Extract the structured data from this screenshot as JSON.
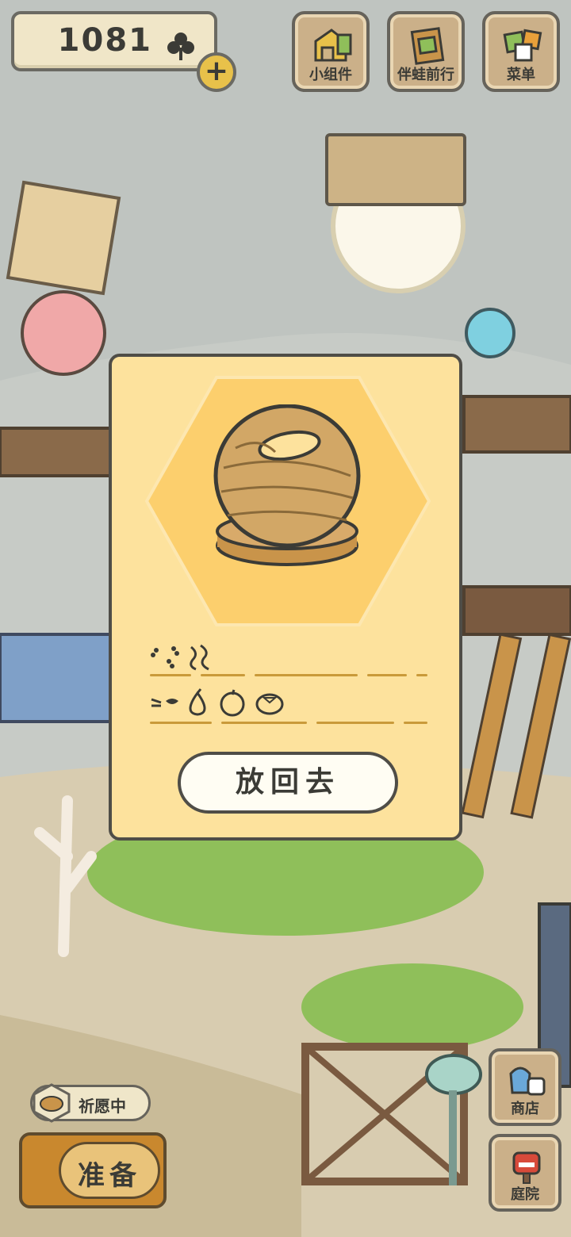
{
  "currency": {
    "clover_count": "1081",
    "icon": "clover-icon",
    "add_icon": "plus-icon"
  },
  "top_menu": [
    {
      "label": "小组件",
      "icon": "widget-icon"
    },
    {
      "label": "伴蛙前行",
      "icon": "album-icon"
    },
    {
      "label": "菜单",
      "icon": "menu-cards-icon"
    }
  ],
  "side_menu": [
    {
      "label": "商店",
      "icon": "shop-bags-icon"
    },
    {
      "label": "庭院",
      "icon": "yard-mailbox-icon"
    }
  ],
  "wish": {
    "label": "祈愿中",
    "icon": "bread-icon"
  },
  "prepare": {
    "label": "准备"
  },
  "dialog": {
    "item_icon": "wooden-ring-ornament-icon",
    "clue_icons_row1": [
      "footprints-icon",
      "wind-icon"
    ],
    "clue_icons_row2": [
      "eyes-icon",
      "pear-icon",
      "apple-icon",
      "persimmon-icon"
    ],
    "return_label": "放回去"
  },
  "colors": {
    "dialog_bg": "#fde29d",
    "hex_bg": "#fccf6d",
    "accent": "#e8c14a"
  }
}
